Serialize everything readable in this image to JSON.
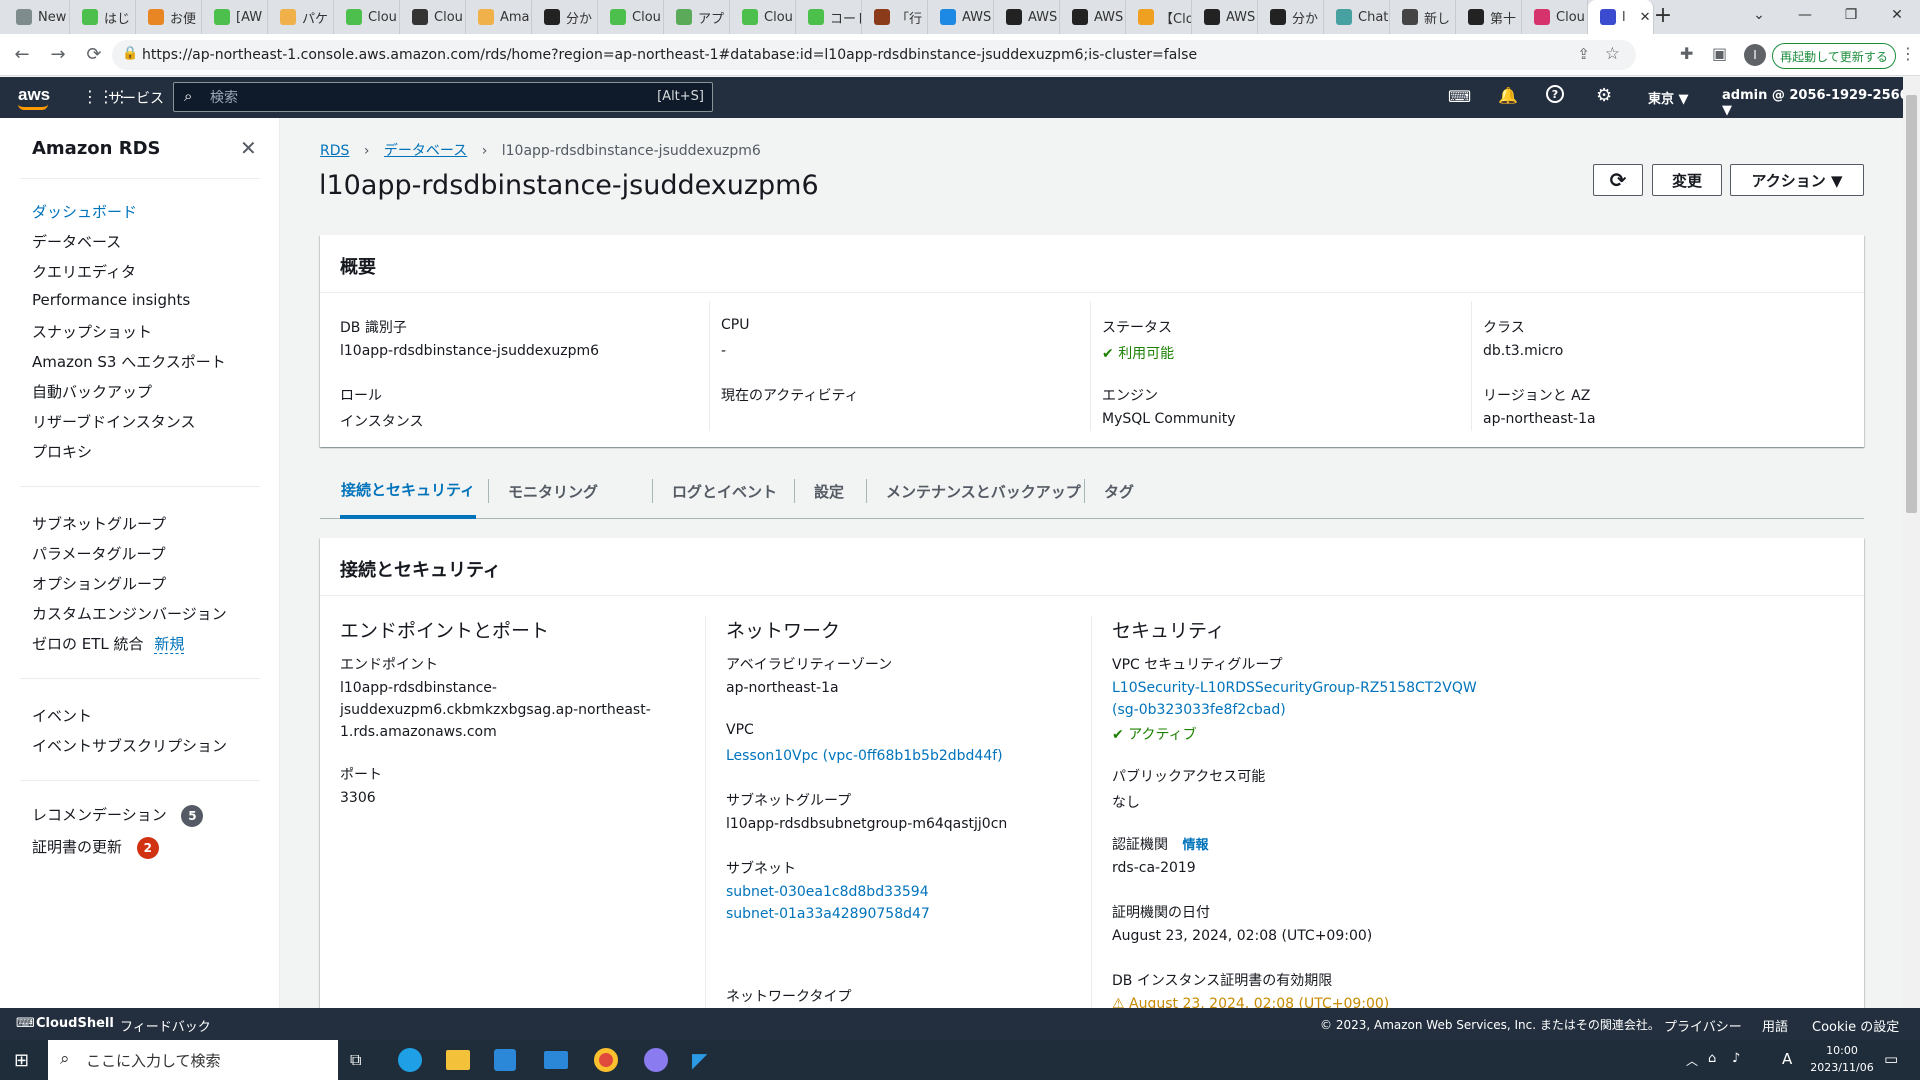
{
  "browser": {
    "tabs": [
      "New",
      "はじ",
      "お便",
      "[AW",
      "パケ",
      "Clou",
      "Clou",
      "Ama",
      "分か",
      "Clou",
      "アプ",
      "Clou",
      "コード",
      "「行",
      "AWS",
      "AWS",
      "AWS",
      "【Clo",
      "AWS",
      "分か",
      "Chat",
      "新し",
      "第十",
      "Clou",
      "l"
    ],
    "url": "https://ap-northeast-1.console.aws.amazon.com/rds/home?region=ap-northeast-1#database:id=l10app-rdsdbinstance-jsuddexuzpm6;is-cluster=false",
    "relaunch": "再起動して更新する",
    "profile_initial": "I"
  },
  "aws_nav": {
    "logo": "aws",
    "services": "サービス",
    "search_placeholder": "検索",
    "search_shortcut": "[Alt+S]",
    "region": "東京 ▼",
    "account": "admin @ 2056-1929-2566 ▼"
  },
  "sidebar": {
    "title": "Amazon RDS",
    "group1": [
      "ダッシュボード",
      "データベース",
      "クエリエディタ",
      "Performance insights",
      "スナップショット",
      "Amazon S3 へエクスポート",
      "自動バックアップ",
      "リザーブドインスタンス",
      "プロキシ"
    ],
    "group2": [
      "サブネットグループ",
      "パラメータグループ",
      "オプショングループ",
      "カスタムエンジンバージョン"
    ],
    "etl_label": "ゼロの ETL 統合",
    "etl_new": "新規",
    "group3": [
      "イベント",
      "イベントサブスクリプション"
    ],
    "recommend_label": "レコメンデーション",
    "recommend_count": "5",
    "cert_label": "証明書の更新",
    "cert_count": "2"
  },
  "breadcrumb": {
    "rds": "RDS",
    "databases": "データベース",
    "current": "l10app-rdsdbinstance-jsuddexuzpm6"
  },
  "page_title": "l10app-rdsdbinstance-jsuddexuzpm6",
  "actions": {
    "refresh": "⟳",
    "modify": "変更",
    "actions": "アクション ▼"
  },
  "summary": {
    "title": "概要",
    "db_id_label": "DB 識別子",
    "db_id": "l10app-rdsdbinstance-jsuddexuzpm6",
    "role_label": "ロール",
    "role": "インスタンス",
    "cpu_label": "CPU",
    "cpu": "-",
    "activity_label": "現在のアクティビティ",
    "status_label": "ステータス",
    "status": "利用可能",
    "engine_label": "エンジン",
    "engine": "MySQL Community",
    "class_label": "クラス",
    "class": "db.t3.micro",
    "region_label": "リージョンと AZ",
    "region": "ap-northeast-1a"
  },
  "tabs": [
    "接続とセキュリティ",
    "モニタリング",
    "ログとイベント",
    "設定",
    "メンテナンスとバックアップ",
    "タグ"
  ],
  "conn": {
    "title": "接続とセキュリティ",
    "endpoint_section": "エンドポイントとポート",
    "endpoint_label": "エンドポイント",
    "endpoint_lines": [
      "l10app-rdsdbinstance-",
      "jsuddexuzpm6.ckbmkzxbgsag.ap-northeast-",
      "1.rds.amazonaws.com"
    ],
    "port_label": "ポート",
    "port": "3306",
    "network_section": "ネットワーク",
    "az_label": "アベイラビリティーゾーン",
    "az": "ap-northeast-1a",
    "vpc_label": "VPC",
    "vpc": "Lesson10Vpc (vpc-0ff68b1b5b2dbd44f)",
    "subnet_group_label": "サブネットグループ",
    "subnet_group": "l10app-rdsdbsubnetgroup-m64qastjj0cn",
    "subnet_label": "サブネット",
    "subnets": [
      "subnet-030ea1c8d8bd33594",
      "subnet-01a33a42890758d47"
    ],
    "network_type_label": "ネットワークタイプ",
    "security_section": "セキュリティ",
    "sg_label": "VPC セキュリティグループ",
    "sg_name": "L10Security-L10RDSSecurityGroup-RZ5158CT2VQW",
    "sg_id": "(sg-0b323033fe8f2cbad)",
    "sg_status": "アクティブ",
    "public_label": "パブリックアクセス可能",
    "public": "なし",
    "ca_label": "認証機関",
    "ca_info": "情報",
    "ca": "rds-ca-2019",
    "ca_date_label": "証明機関の日付",
    "ca_date": "August 23, 2024, 02:08 (UTC+09:00)",
    "cert_expiry_label": "DB インスタンス証明書の有効期限",
    "cert_expiry": "August 23, 2024, 02:08 (UTC+09:00)"
  },
  "footer": {
    "cloudshell": "CloudShell",
    "feedback": "フィードバック",
    "copyright": "© 2023, Amazon Web Services, Inc. またはその関連会社。",
    "privacy": "プライバシー",
    "terms": "用語",
    "cookie": "Cookie の設定"
  },
  "taskbar": {
    "search_placeholder": "ここに入力して検索",
    "time": "10:00",
    "date": "2023/11/06",
    "ime": "A"
  },
  "colors": {
    "aws_nav": "#232f3e",
    "link": "#0073bb",
    "ok": "#1d8102",
    "active_tab": "#0073bb",
    "badge_dark": "#545b64",
    "badge_red": "#d13212"
  }
}
